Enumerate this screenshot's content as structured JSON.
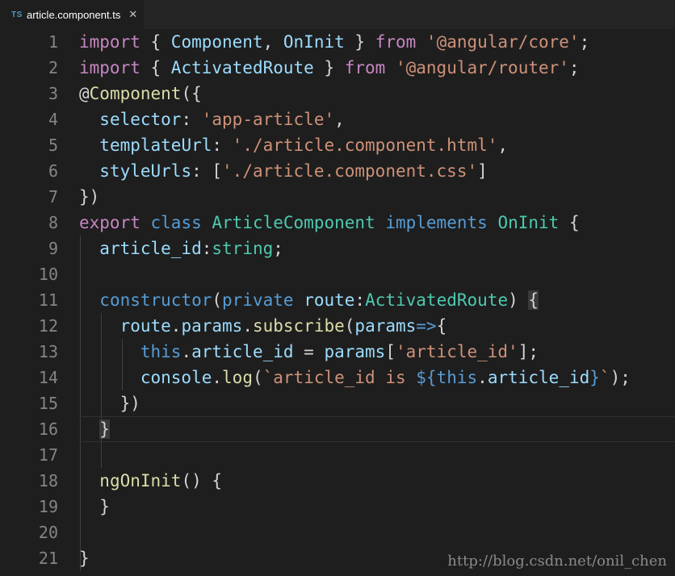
{
  "tab": {
    "icon_text": "TS",
    "title": "article.component.ts",
    "close_glyph": "✕"
  },
  "editor": {
    "line_numbers": [
      "1",
      "2",
      "3",
      "4",
      "5",
      "6",
      "7",
      "8",
      "9",
      "10",
      "11",
      "12",
      "13",
      "14",
      "15",
      "16",
      "17",
      "18",
      "19",
      "20",
      "21"
    ],
    "lines": [
      [
        [
          "ctl",
          "import"
        ],
        [
          "pun",
          " { "
        ],
        [
          "var",
          "Component"
        ],
        [
          "pun",
          ", "
        ],
        [
          "var",
          "OnInit"
        ],
        [
          "pun",
          " } "
        ],
        [
          "ctl",
          "from"
        ],
        [
          "pun",
          " "
        ],
        [
          "str",
          "'@angular/core'"
        ],
        [
          "pun",
          ";"
        ]
      ],
      [
        [
          "ctl",
          "import"
        ],
        [
          "pun",
          " { "
        ],
        [
          "var",
          "ActivatedRoute"
        ],
        [
          "pun",
          " } "
        ],
        [
          "ctl",
          "from"
        ],
        [
          "pun",
          " "
        ],
        [
          "str",
          "'@angular/router'"
        ],
        [
          "pun",
          ";"
        ]
      ],
      [
        [
          "pun",
          "@"
        ],
        [
          "fn",
          "Component"
        ],
        [
          "pun",
          "({"
        ]
      ],
      [
        [
          "pun",
          "  "
        ],
        [
          "var",
          "selector"
        ],
        [
          "pun",
          ": "
        ],
        [
          "str",
          "'app-article'"
        ],
        [
          "pun",
          ","
        ]
      ],
      [
        [
          "pun",
          "  "
        ],
        [
          "var",
          "templateUrl"
        ],
        [
          "pun",
          ": "
        ],
        [
          "str",
          "'./article.component.html'"
        ],
        [
          "pun",
          ","
        ]
      ],
      [
        [
          "pun",
          "  "
        ],
        [
          "var",
          "styleUrls"
        ],
        [
          "pun",
          ": ["
        ],
        [
          "str",
          "'./article.component.css'"
        ],
        [
          "pun",
          "]"
        ]
      ],
      [
        [
          "pun",
          "})"
        ]
      ],
      [
        [
          "ctl",
          "export"
        ],
        [
          "pun",
          " "
        ],
        [
          "kw",
          "class"
        ],
        [
          "pun",
          " "
        ],
        [
          "typ",
          "ArticleComponent"
        ],
        [
          "pun",
          " "
        ],
        [
          "kw",
          "implements"
        ],
        [
          "pun",
          " "
        ],
        [
          "typ",
          "OnInit"
        ],
        [
          "pun",
          " {"
        ]
      ],
      [
        [
          "pun",
          "  "
        ],
        [
          "var",
          "article_id"
        ],
        [
          "pun",
          ":"
        ],
        [
          "typ",
          "string"
        ],
        [
          "pun",
          ";"
        ]
      ],
      [],
      [
        [
          "pun",
          "  "
        ],
        [
          "kw",
          "constructor"
        ],
        [
          "pun",
          "("
        ],
        [
          "kw",
          "private"
        ],
        [
          "pun",
          " "
        ],
        [
          "var",
          "route"
        ],
        [
          "pun",
          ":"
        ],
        [
          "typ",
          "ActivatedRoute"
        ],
        [
          "pun",
          ") "
        ],
        [
          "hl",
          "{"
        ]
      ],
      [
        [
          "pun",
          "    "
        ],
        [
          "var",
          "route"
        ],
        [
          "pun",
          "."
        ],
        [
          "var",
          "params"
        ],
        [
          "pun",
          "."
        ],
        [
          "fn",
          "subscribe"
        ],
        [
          "pun",
          "("
        ],
        [
          "var",
          "params"
        ],
        [
          "kw",
          "=>"
        ],
        [
          "pun",
          "{"
        ]
      ],
      [
        [
          "pun",
          "      "
        ],
        [
          "kw",
          "this"
        ],
        [
          "pun",
          "."
        ],
        [
          "var",
          "article_id"
        ],
        [
          "pun",
          " = "
        ],
        [
          "var",
          "params"
        ],
        [
          "pun",
          "["
        ],
        [
          "str",
          "'article_id'"
        ],
        [
          "pun",
          "];"
        ]
      ],
      [
        [
          "pun",
          "      "
        ],
        [
          "var",
          "console"
        ],
        [
          "pun",
          "."
        ],
        [
          "fn",
          "log"
        ],
        [
          "pun",
          "("
        ],
        [
          "str",
          "`article_id is "
        ],
        [
          "kw",
          "${"
        ],
        [
          "kw",
          "this"
        ],
        [
          "pun",
          "."
        ],
        [
          "var",
          "article_id"
        ],
        [
          "kw",
          "}"
        ],
        [
          "str",
          "`"
        ],
        [
          "pun",
          ");"
        ]
      ],
      [
        [
          "pun",
          "    })"
        ]
      ],
      [
        [
          "pun",
          "  "
        ],
        [
          "hl",
          "}"
        ]
      ],
      [],
      [
        [
          "pun",
          "  "
        ],
        [
          "fn",
          "ngOnInit"
        ],
        [
          "pun",
          "() {"
        ]
      ],
      [
        [
          "pun",
          "  }"
        ]
      ],
      [],
      [
        [
          "pun",
          "}"
        ]
      ]
    ]
  },
  "watermark": "http://blog.csdn.net/onil_chen"
}
